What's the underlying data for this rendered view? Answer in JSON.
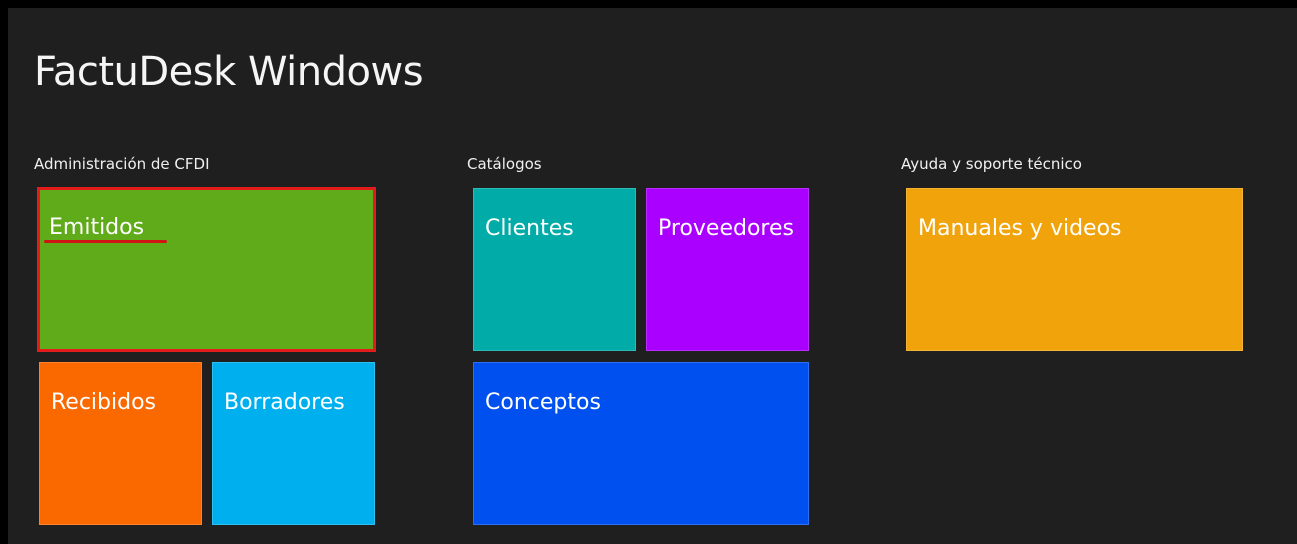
{
  "app": {
    "title": "FactuDesk Windows"
  },
  "groups": {
    "admin": {
      "header": "Administración de CFDI",
      "tiles": {
        "emitidos": {
          "label": "Emitidos",
          "color": "#60ab1a",
          "selected": true
        },
        "recibidos": {
          "label": "Recibidos",
          "color": "#fa6800"
        },
        "borradores": {
          "label": "Borradores",
          "color": "#00b0ee"
        }
      }
    },
    "catalogos": {
      "header": "Catálogos",
      "tiles": {
        "clientes": {
          "label": "Clientes",
          "color": "#00aba8"
        },
        "proveedores": {
          "label": "Proveedores",
          "color": "#aa00ff"
        },
        "conceptos": {
          "label": "Conceptos",
          "color": "#0050ef"
        }
      }
    },
    "ayuda": {
      "header": "Ayuda y soporte técnico",
      "tiles": {
        "manuales": {
          "label": "Manuales y videos",
          "color": "#f0a30a"
        }
      }
    }
  },
  "colors": {
    "background": "#1f1f1f",
    "selection_border": "#e31b1b"
  }
}
